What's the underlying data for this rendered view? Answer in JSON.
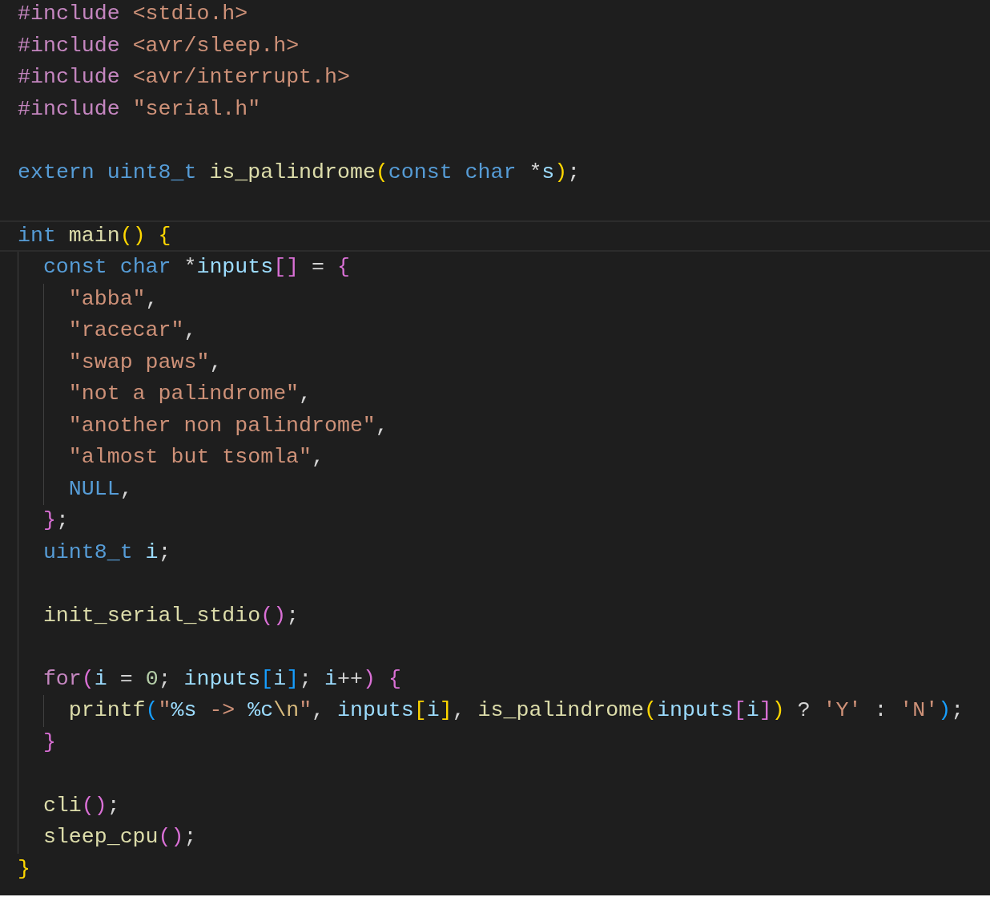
{
  "editor": {
    "lines": [
      {
        "current": false,
        "tokens": [
          {
            "text": "#include ",
            "kind": "keyword"
          },
          {
            "text": "<stdio.h>",
            "kind": "string"
          }
        ]
      },
      {
        "current": false,
        "tokens": [
          {
            "text": "#include ",
            "kind": "keyword"
          },
          {
            "text": "<avr/sleep.h>",
            "kind": "string"
          }
        ]
      },
      {
        "current": false,
        "tokens": [
          {
            "text": "#include ",
            "kind": "keyword"
          },
          {
            "text": "<avr/interrupt.h>",
            "kind": "string"
          }
        ]
      },
      {
        "current": false,
        "tokens": [
          {
            "text": "#include ",
            "kind": "keyword"
          },
          {
            "text": "\"serial.h\"",
            "kind": "string"
          }
        ]
      },
      {
        "current": false
      },
      {
        "current": false,
        "tokens": [
          {
            "text": "extern ",
            "kind": "type"
          },
          {
            "text": "uint8_t ",
            "kind": "type"
          },
          {
            "text": "is_palindrome",
            "kind": "func"
          },
          {
            "text": "(",
            "kind": "br1"
          },
          {
            "text": "const ",
            "kind": "type"
          },
          {
            "text": "char ",
            "kind": "type"
          },
          {
            "text": "*",
            "kind": "plain"
          },
          {
            "text": "s",
            "kind": "var"
          },
          {
            "text": ")",
            "kind": "br1"
          },
          {
            "text": ";",
            "kind": "plain"
          }
        ]
      },
      {
        "current": false
      },
      {
        "current": true,
        "tokens": [
          {
            "text": "int ",
            "kind": "type"
          },
          {
            "text": "main",
            "kind": "func"
          },
          {
            "text": "() {",
            "kind": "br1"
          }
        ],
        "children": [
          {
            "current": false,
            "tokens": [
              {
                "text": "const ",
                "kind": "type"
              },
              {
                "text": "char ",
                "kind": "type"
              },
              {
                "text": "*",
                "kind": "plain"
              },
              {
                "text": "inputs",
                "kind": "var"
              },
              {
                "text": "[]",
                "kind": "br2"
              },
              {
                "text": " = ",
                "kind": "plain"
              },
              {
                "text": "{",
                "kind": "br2"
              }
            ],
            "children": [
              {
                "current": false,
                "tokens": [
                  {
                    "text": "\"abba\"",
                    "kind": "string"
                  },
                  {
                    "text": ",",
                    "kind": "plain"
                  }
                ]
              },
              {
                "current": false,
                "tokens": [
                  {
                    "text": "\"racecar\"",
                    "kind": "string"
                  },
                  {
                    "text": ",",
                    "kind": "plain"
                  }
                ]
              },
              {
                "current": false,
                "tokens": [
                  {
                    "text": "\"swap paws\"",
                    "kind": "string"
                  },
                  {
                    "text": ",",
                    "kind": "plain"
                  }
                ]
              },
              {
                "current": false,
                "tokens": [
                  {
                    "text": "\"not a palindrome\"",
                    "kind": "string"
                  },
                  {
                    "text": ",",
                    "kind": "plain"
                  }
                ]
              },
              {
                "current": false,
                "tokens": [
                  {
                    "text": "\"another non palindrome\"",
                    "kind": "string"
                  },
                  {
                    "text": ",",
                    "kind": "plain"
                  }
                ]
              },
              {
                "current": false,
                "tokens": [
                  {
                    "text": "\"almost but tsomla\"",
                    "kind": "string"
                  },
                  {
                    "text": ",",
                    "kind": "plain"
                  }
                ]
              },
              {
                "current": false,
                "tokens": [
                  {
                    "text": "NULL",
                    "kind": "type"
                  },
                  {
                    "text": ",",
                    "kind": "plain"
                  }
                ]
              }
            ]
          },
          {
            "current": false,
            "tokens": [
              {
                "text": "}",
                "kind": "br2"
              },
              {
                "text": ";",
                "kind": "plain"
              }
            ]
          },
          {
            "current": false,
            "tokens": [
              {
                "text": "uint8_t ",
                "kind": "type"
              },
              {
                "text": "i",
                "kind": "var"
              },
              {
                "text": ";",
                "kind": "plain"
              }
            ]
          },
          {
            "current": false
          },
          {
            "current": false,
            "tokens": [
              {
                "text": "init_serial_stdio",
                "kind": "func"
              },
              {
                "text": "()",
                "kind": "br2"
              },
              {
                "text": ";",
                "kind": "plain"
              }
            ]
          },
          {
            "current": false
          },
          {
            "current": false,
            "tokens": [
              {
                "text": "for",
                "kind": "keyword"
              },
              {
                "text": "(",
                "kind": "br2"
              },
              {
                "text": "i",
                "kind": "var"
              },
              {
                "text": " = ",
                "kind": "plain"
              },
              {
                "text": "0",
                "kind": "num"
              },
              {
                "text": "; ",
                "kind": "plain"
              },
              {
                "text": "inputs",
                "kind": "var"
              },
              {
                "text": "[",
                "kind": "br3"
              },
              {
                "text": "i",
                "kind": "var"
              },
              {
                "text": "]",
                "kind": "br3"
              },
              {
                "text": "; ",
                "kind": "plain"
              },
              {
                "text": "i",
                "kind": "var"
              },
              {
                "text": "++",
                "kind": "plain"
              },
              {
                "text": ") {",
                "kind": "br2"
              }
            ],
            "children": [
              {
                "current": false,
                "tokens": [
                  {
                    "text": "printf",
                    "kind": "func"
                  },
                  {
                    "text": "(",
                    "kind": "br3"
                  },
                  {
                    "text": "\"",
                    "kind": "string"
                  },
                  {
                    "text": "%s",
                    "kind": "var"
                  },
                  {
                    "text": " -> ",
                    "kind": "string"
                  },
                  {
                    "text": "%c",
                    "kind": "var"
                  },
                  {
                    "text": "\\n",
                    "kind": "escape"
                  },
                  {
                    "text": "\"",
                    "kind": "string"
                  },
                  {
                    "text": ", ",
                    "kind": "plain"
                  },
                  {
                    "text": "inputs",
                    "kind": "var"
                  },
                  {
                    "text": "[",
                    "kind": "br1"
                  },
                  {
                    "text": "i",
                    "kind": "var"
                  },
                  {
                    "text": "]",
                    "kind": "br1"
                  },
                  {
                    "text": ", ",
                    "kind": "plain"
                  },
                  {
                    "text": "is_palindrome",
                    "kind": "func"
                  },
                  {
                    "text": "(",
                    "kind": "br1"
                  },
                  {
                    "text": "inputs",
                    "kind": "var"
                  },
                  {
                    "text": "[",
                    "kind": "br2"
                  },
                  {
                    "text": "i",
                    "kind": "var"
                  },
                  {
                    "text": "]",
                    "kind": "br2"
                  },
                  {
                    "text": ")",
                    "kind": "br1"
                  },
                  {
                    "text": " ? ",
                    "kind": "plain"
                  },
                  {
                    "text": "'Y'",
                    "kind": "string"
                  },
                  {
                    "text": " : ",
                    "kind": "plain"
                  },
                  {
                    "text": "'N'",
                    "kind": "string"
                  },
                  {
                    "text": ")",
                    "kind": "br3"
                  },
                  {
                    "text": ";",
                    "kind": "plain"
                  }
                ]
              }
            ]
          },
          {
            "current": false,
            "tokens": [
              {
                "text": "}",
                "kind": "br2"
              }
            ]
          },
          {
            "current": false
          },
          {
            "current": false,
            "tokens": [
              {
                "text": "cli",
                "kind": "func"
              },
              {
                "text": "()",
                "kind": "br2"
              },
              {
                "text": ";",
                "kind": "plain"
              }
            ]
          },
          {
            "current": false,
            "tokens": [
              {
                "text": "sleep_cpu",
                "kind": "func"
              },
              {
                "text": "()",
                "kind": "br2"
              },
              {
                "text": ";",
                "kind": "plain"
              }
            ]
          }
        ]
      },
      {
        "current": false,
        "tokens": [
          {
            "text": "}",
            "kind": "br1"
          }
        ]
      }
    ]
  }
}
